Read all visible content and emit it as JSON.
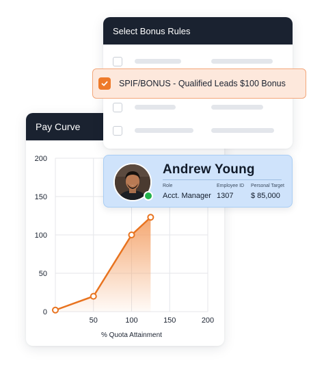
{
  "pay_curve": {
    "title": "Pay Curve"
  },
  "chart_data": {
    "type": "area",
    "title": "Pay Curve",
    "xlabel": "% Quota Attainment",
    "ylabel": "",
    "xlim": [
      0,
      200
    ],
    "ylim": [
      0,
      200
    ],
    "x_ticks": [
      "50",
      "100",
      "150",
      "200"
    ],
    "y_ticks": [
      "0",
      "50",
      "100",
      "150",
      "200"
    ],
    "grid": true,
    "series": [
      {
        "x": [
          0,
          50,
          100,
          125
        ],
        "y": [
          2,
          20,
          100,
          123
        ]
      }
    ],
    "line_color": "#e8731f",
    "fill_color": "#f4a36a"
  },
  "bonus_rules": {
    "title": "Select Bonus Rules",
    "selected_rule": "SPIF/BONUS - Qualified Leads $100 Bonus",
    "selected_checked": true,
    "accent": "#ee7a2a"
  },
  "employee": {
    "name": "Andrew Young",
    "role_label": "Role",
    "role": "Acct. Manager",
    "id_label": "Employee ID",
    "id": "1307",
    "target_label": "Personal Target",
    "target": "$ 85,000",
    "status_color": "#22b24c"
  }
}
